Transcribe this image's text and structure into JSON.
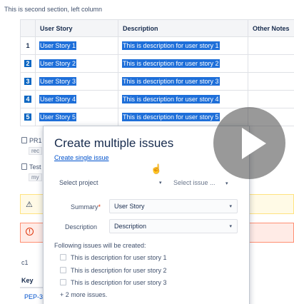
{
  "section_title": "This is second section, left column",
  "table": {
    "headers": [
      "",
      "User Story",
      "Description",
      "Other Notes"
    ],
    "rows": [
      {
        "num": "1",
        "story": "User Story 1",
        "desc": "This is description for user story 1"
      },
      {
        "num": "2",
        "story": "User Story 2",
        "desc": "This is description for user story 2"
      },
      {
        "num": "3",
        "story": "User Story 3",
        "desc": "This is description for user story 3"
      },
      {
        "num": "4",
        "story": "User Story 4",
        "desc": "This is description for user story 4"
      },
      {
        "num": "5",
        "story": "User Story 5",
        "desc": "This is description for user story 5"
      }
    ]
  },
  "side": {
    "pr_label": "PR1",
    "pr_chip": "rec",
    "test_label": "Test",
    "test_chip": "my",
    "c1": "c1",
    "key_header": "Key",
    "key_link": "PEP-3"
  },
  "modal": {
    "title": "Create multiple issues",
    "create_single_link": "Create single issue",
    "select_project_label": "Select project",
    "select_issue_placeholder": "Select issue ...",
    "summary_label": "Summary",
    "summary_required": "*",
    "summary_value": "User Story",
    "description_label": "Description",
    "description_value": "Description",
    "following_text": "Following issues will be created:",
    "issues": [
      "This is description for user story 1",
      "This is description for user story 2",
      "This is description for user story 3"
    ],
    "more_text": "+ 2 more issues."
  },
  "icons": {
    "caret": "▾",
    "warning": "⚠",
    "error": "!",
    "cursor": "☝"
  },
  "colors": {
    "selection": "#1e6fd9",
    "link": "#0052cc",
    "warning_bg": "#fffae6",
    "error_bg": "#ffebe6"
  }
}
